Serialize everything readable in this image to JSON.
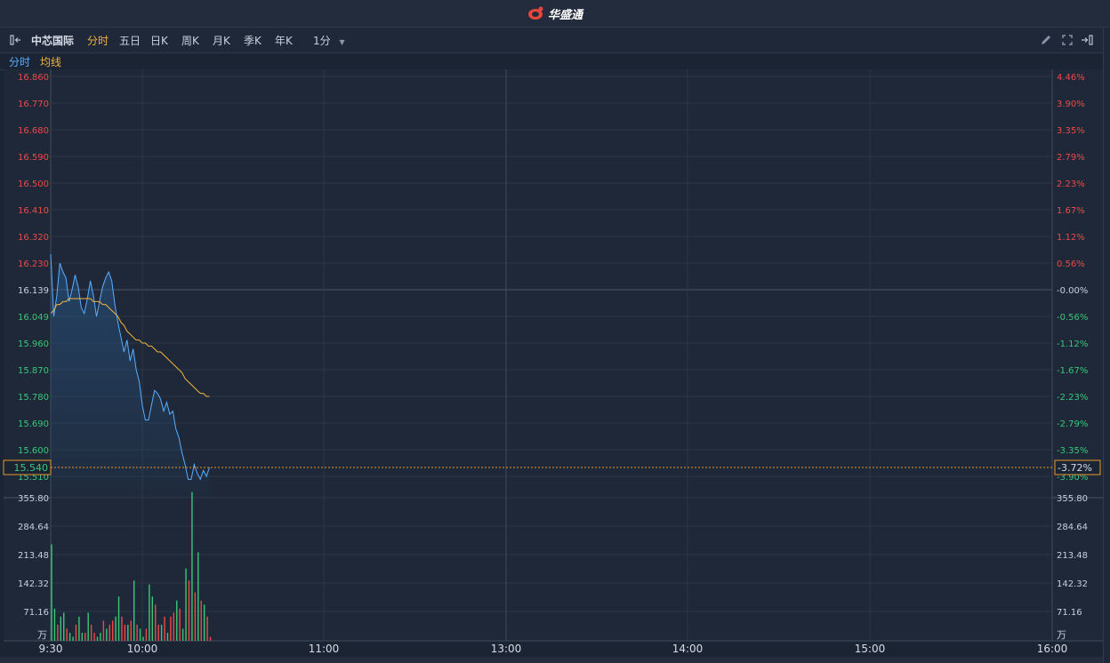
{
  "brand": {
    "name": "华盛通"
  },
  "toolbar": {
    "stock_name": "中芯国际",
    "tabs": [
      "分时",
      "五日",
      "日K",
      "周K",
      "月K",
      "季K",
      "年K"
    ],
    "active_tab": "分时",
    "interval": "1分"
  },
  "subbar": {
    "mode": "分时",
    "avg_label": "均线"
  },
  "colors": {
    "price_line": "#5aaeff",
    "avg_line": "#f0b43c",
    "up": "#f04848",
    "down": "#38c878",
    "grid": "#2b3647"
  },
  "chart_data": {
    "type": "line",
    "title": "",
    "prev_close": 16.139,
    "current_price": "15.540",
    "current_change": "-3.72%",
    "price_ticks": [
      "16.860",
      "16.770",
      "16.680",
      "16.590",
      "16.500",
      "16.410",
      "16.320",
      "16.230",
      "16.139",
      "16.049",
      "15.960",
      "15.870",
      "15.780",
      "15.690",
      "15.600",
      "15.510"
    ],
    "pct_ticks": [
      "4.46%",
      "3.90%",
      "3.35%",
      "2.79%",
      "2.23%",
      "1.67%",
      "1.12%",
      "0.56%",
      "-0.00%",
      "-0.56%",
      "-1.12%",
      "-1.67%",
      "-2.23%",
      "-2.79%",
      "-3.35%",
      "-3.90%"
    ],
    "volume_ticks": [
      "355.80",
      "284.64",
      "213.48",
      "142.32",
      "71.16"
    ],
    "volume_unit": "万",
    "time_ticks": [
      "9:30",
      "10:00",
      "11:00",
      "13:00",
      "14:00",
      "15:00",
      "16:00"
    ],
    "price": [
      16.26,
      16.05,
      16.12,
      16.23,
      16.2,
      16.18,
      16.1,
      16.14,
      16.19,
      16.15,
      16.08,
      16.06,
      16.11,
      16.17,
      16.12,
      16.05,
      16.1,
      16.15,
      16.18,
      16.2,
      16.17,
      16.09,
      16.03,
      15.98,
      15.93,
      15.97,
      15.9,
      15.94,
      15.87,
      15.83,
      15.75,
      15.7,
      15.7,
      15.75,
      15.8,
      15.79,
      15.77,
      15.73,
      15.76,
      15.72,
      15.73,
      15.67,
      15.64,
      15.59,
      15.55,
      15.5,
      15.5,
      15.55,
      15.52,
      15.5,
      15.53,
      15.51,
      15.54
    ],
    "avg": [
      16.06,
      16.07,
      16.09,
      16.09,
      16.1,
      16.1,
      16.11,
      16.11,
      16.11,
      16.11,
      16.11,
      16.11,
      16.11,
      16.11,
      16.1,
      16.1,
      16.1,
      16.09,
      16.09,
      16.08,
      16.07,
      16.06,
      16.05,
      16.03,
      16.02,
      16.0,
      15.99,
      15.98,
      15.97,
      15.97,
      15.96,
      15.96,
      15.95,
      15.95,
      15.94,
      15.93,
      15.93,
      15.92,
      15.91,
      15.9,
      15.89,
      15.88,
      15.87,
      15.86,
      15.84,
      15.83,
      15.82,
      15.81,
      15.8,
      15.79,
      15.79,
      15.78,
      15.78
    ],
    "volume": [
      240,
      80,
      40,
      60,
      70,
      30,
      20,
      10,
      40,
      60,
      20,
      20,
      70,
      40,
      20,
      10,
      20,
      50,
      30,
      40,
      50,
      60,
      110,
      60,
      40,
      40,
      50,
      150,
      40,
      30,
      10,
      30,
      140,
      110,
      90,
      40,
      40,
      60,
      20,
      60,
      70,
      100,
      80,
      30,
      180,
      150,
      370,
      120,
      220,
      100,
      90,
      60,
      10
    ],
    "volume_dir": [
      "down",
      "down",
      "up",
      "down",
      "down",
      "up",
      "down",
      "down",
      "up",
      "down",
      "down",
      "up",
      "down",
      "up",
      "up",
      "down",
      "down",
      "up",
      "down",
      "up",
      "up",
      "down",
      "down",
      "up",
      "up",
      "down",
      "up",
      "down",
      "up",
      "down",
      "down",
      "up",
      "down",
      "down",
      "up",
      "up",
      "down",
      "up",
      "down",
      "up",
      "up",
      "down",
      "up",
      "down",
      "down",
      "up",
      "down",
      "up",
      "down",
      "up",
      "down",
      "up",
      "up"
    ]
  }
}
